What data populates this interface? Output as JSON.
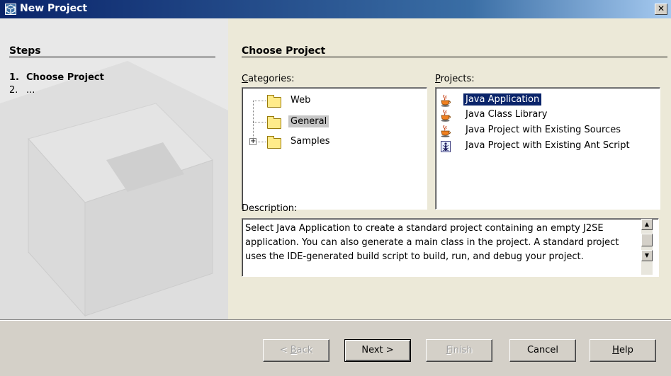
{
  "window": {
    "title": "New Project",
    "close_glyph": "✕"
  },
  "steps": {
    "heading": "Steps",
    "items": [
      {
        "num": "1.",
        "label": "Choose Project"
      },
      {
        "num": "2.",
        "label": "..."
      }
    ]
  },
  "main": {
    "heading": "Choose Project",
    "categories_label_underlined": "C",
    "categories_label_rest": "ategories:",
    "categories": [
      {
        "label": "Web",
        "icon": "folder-icon",
        "selected": false
      },
      {
        "label": "General",
        "icon": "folder-icon",
        "selected": true
      },
      {
        "label": "Samples",
        "icon": "folder-icon",
        "selected": false,
        "expandable": true
      }
    ],
    "projects_label_underlined": "P",
    "projects_label_rest": "rojects:",
    "projects": [
      {
        "label": "Java Application",
        "icon": "java-cup-icon",
        "selected": true
      },
      {
        "label": "Java Class Library",
        "icon": "java-cup-icon",
        "selected": false
      },
      {
        "label": "Java Project with Existing Sources",
        "icon": "java-cup-icon",
        "selected": false
      },
      {
        "label": "Java Project with Existing Ant Script",
        "icon": "ant-icon",
        "selected": false
      }
    ],
    "description_label": "Description:",
    "description": "Select Java Application to create a standard project containing an empty J2SE application. You can also generate a main class in the project. A standard project uses the IDE-generated build script to build, run, and debug your project."
  },
  "buttons": {
    "back_pre": "< ",
    "back_ul": "B",
    "back_rest": "ack",
    "next": "Next >",
    "finish_ul": "F",
    "finish_rest": "inish",
    "cancel": "Cancel",
    "help_ul": "H",
    "help_rest": "elp"
  },
  "colors": {
    "title_gradient_start": "#0a246a",
    "selection": "#0a246a",
    "dialog_bg": "#d4d0c8",
    "content_bg": "#ece9d8"
  }
}
